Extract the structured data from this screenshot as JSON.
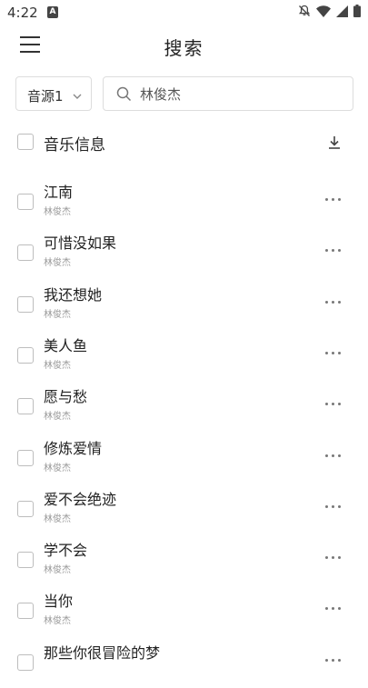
{
  "status_bar": {
    "time": "4:22",
    "notification_badge": "A",
    "icons": [
      "bell-off-icon",
      "wifi-icon",
      "signal-icon",
      "battery-icon"
    ]
  },
  "app_bar": {
    "title": "搜索",
    "menu_icon": "hamburger-menu-icon"
  },
  "search": {
    "source_label": "音源1",
    "query": "林俊杰",
    "search_icon": "search-icon"
  },
  "list_header": {
    "title": "音乐信息",
    "download_icon": "download-icon"
  },
  "songs": [
    {
      "name": "江南",
      "artist": "林俊杰"
    },
    {
      "name": "可惜没如果",
      "artist": "林俊杰"
    },
    {
      "name": "我还想她",
      "artist": "林俊杰"
    },
    {
      "name": "美人鱼",
      "artist": "林俊杰"
    },
    {
      "name": "愿与愁",
      "artist": "林俊杰"
    },
    {
      "name": "修炼爱情",
      "artist": "林俊杰"
    },
    {
      "name": "爱不会绝迹",
      "artist": "林俊杰"
    },
    {
      "name": "学不会",
      "artist": "林俊杰"
    },
    {
      "name": "当你",
      "artist": "林俊杰"
    },
    {
      "name": "那些你很冒险的梦",
      "artist": ""
    }
  ]
}
